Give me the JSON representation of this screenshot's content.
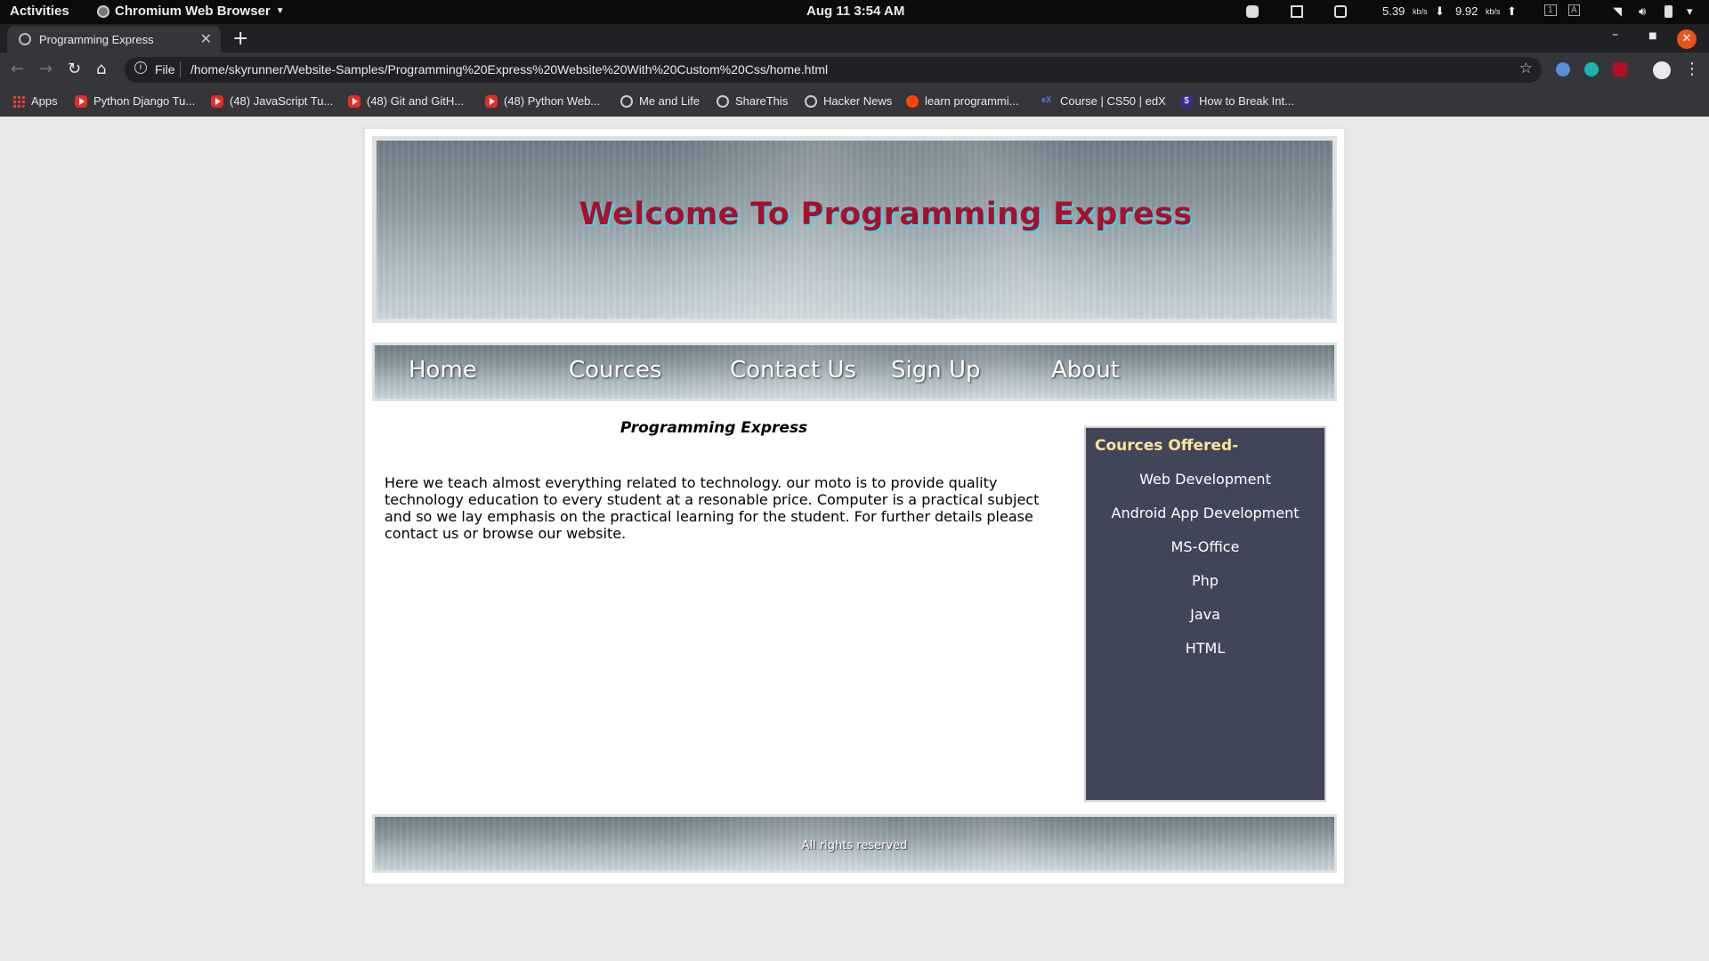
{
  "os": {
    "activities": "Activities",
    "app_name": "Chromium Web Browser",
    "clock": "Aug 11  3:54 AM",
    "net_down": "5.39",
    "net_down_unit": "kb/s",
    "net_up": "9.92",
    "net_up_unit": "kb/s",
    "workspace_1": "1",
    "workspace_a": "A"
  },
  "browser": {
    "tab_title": "Programming Express",
    "url_scheme": "File",
    "url": "/home/skyrunner/Website-Samples/Programming%20Express%20Website%20With%20Custom%20Css/home.html",
    "bookmarks": [
      {
        "label": "Apps",
        "icon": "apps"
      },
      {
        "label": "Python Django Tu...",
        "icon": "yt"
      },
      {
        "label": "(48) JavaScript Tu...",
        "icon": "yt"
      },
      {
        "label": "(48) Git and GitH...",
        "icon": "yt"
      },
      {
        "label": "(48) Python Web...",
        "icon": "yt"
      },
      {
        "label": "Me and Life",
        "icon": "globe"
      },
      {
        "label": "ShareThis",
        "icon": "globe"
      },
      {
        "label": "Hacker News",
        "icon": "globe"
      },
      {
        "label": "learn programmi...",
        "icon": "reddit"
      },
      {
        "label": "Course | CS50 | edX",
        "icon": "edx"
      },
      {
        "label": "How to Break Int...",
        "icon": "dollar"
      }
    ]
  },
  "page": {
    "banner_title": "Welcome To Programming Express",
    "nav": [
      "Home",
      "Cources",
      "Contact Us",
      "Sign Up",
      "About"
    ],
    "heading": "Programming Express",
    "body": "Here we teach almost everything related to technology. our moto is to provide quality technology education to every student at a resonable price. Computer is a practical subject and so we lay emphasis on the practical learning for the student. For further details please contact us or browse our website.",
    "sidebar_title": "Cources Offered-",
    "courses": [
      "Web Development",
      "Android App Development",
      "MS-Office",
      "Php",
      "Java",
      "HTML"
    ],
    "footer": "All rights reserved"
  },
  "colors": {
    "banner_text": "#a5102e",
    "banner_shadow": "#3ad9e6",
    "sidebar_bg": "#414558",
    "sidebar_title": "#ffe39a",
    "close_button": "#e95420"
  }
}
